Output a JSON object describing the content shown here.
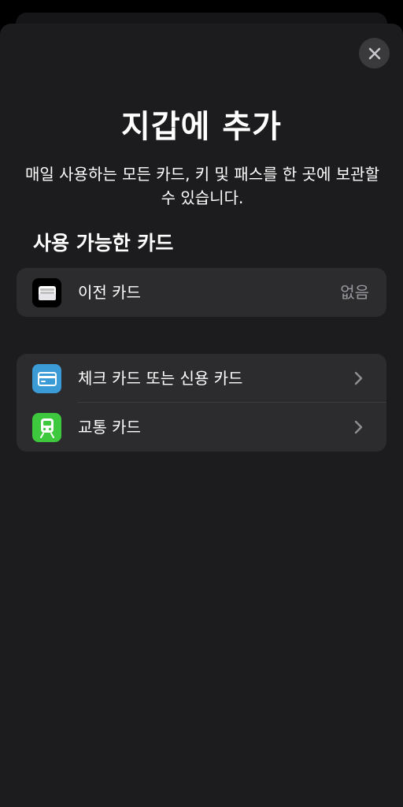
{
  "sheet": {
    "close_icon": "close-icon",
    "title": "지갑에 추가",
    "subtitle": "매일 사용하는 모든 카드, 키 및 패스를 한 곳에 보관할 수 있습니다."
  },
  "available": {
    "header": "사용 가능한 카드",
    "items": [
      {
        "label": "이전 카드",
        "value": "없음",
        "icon": "wallet-icon",
        "icon_bg": "#000000"
      }
    ]
  },
  "add_options": {
    "items": [
      {
        "label": "체크 카드 또는 신용 카드",
        "icon": "credit-card-icon",
        "icon_bg": "#3a9bd6"
      },
      {
        "label": "교통 카드",
        "icon": "transit-icon",
        "icon_bg": "#3dc83e"
      }
    ]
  },
  "colors": {
    "background": "#000000",
    "sheet": "#1c1c1e",
    "row": "#2c2c2e",
    "secondary_text": "#98989f"
  }
}
